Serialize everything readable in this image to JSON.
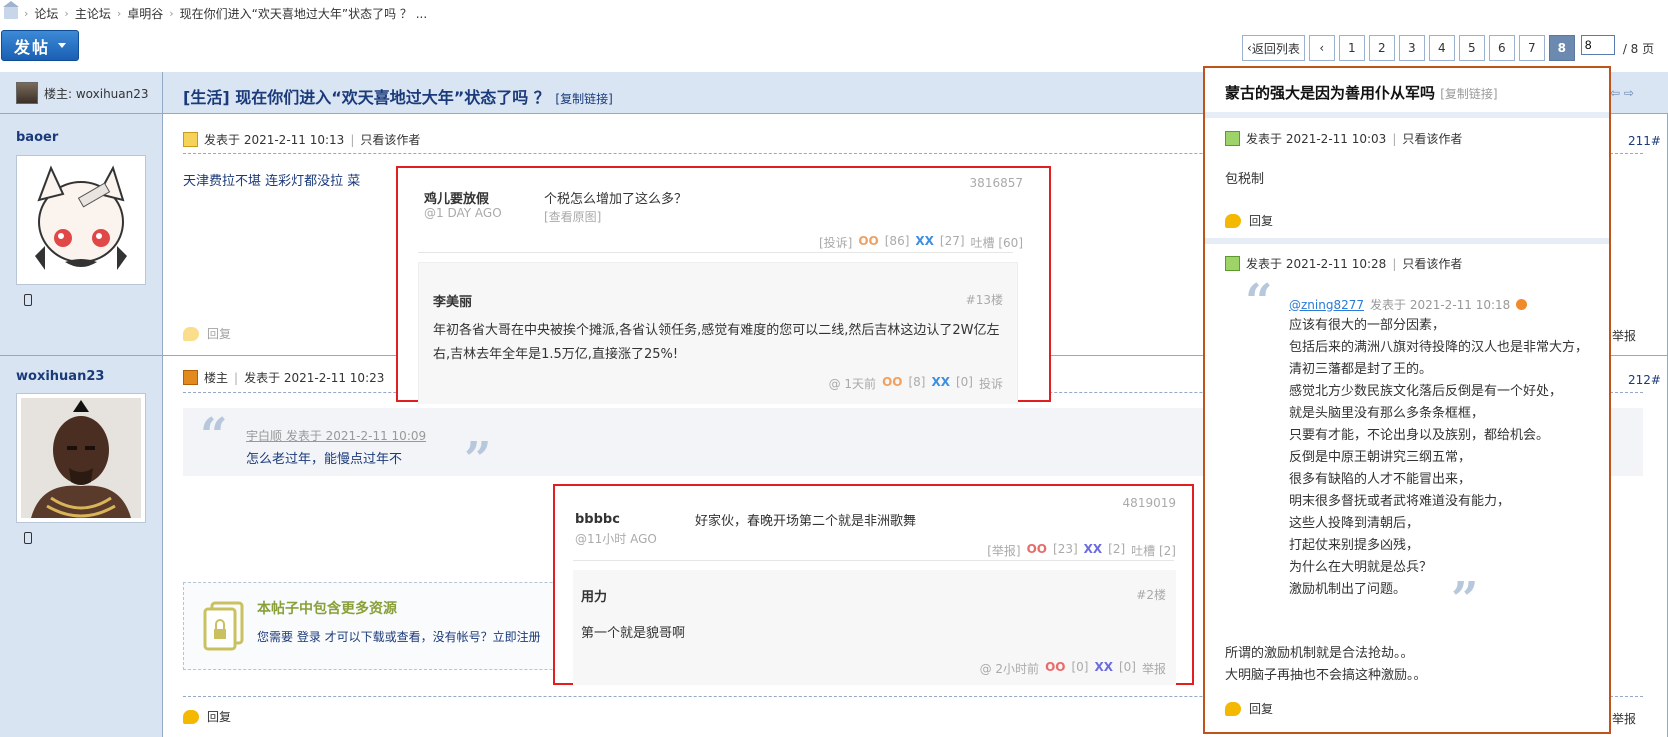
{
  "breadcrumb": {
    "items": [
      "论坛",
      "主论坛",
      "卓明谷",
      "现在你们进入“欢天喜地过大年”状态了吗 ？ ..."
    ]
  },
  "toolbar": {
    "post_label": "发帖"
  },
  "pager": {
    "back_label": "返回列表",
    "pages": [
      "1",
      "2",
      "3",
      "4",
      "5",
      "6",
      "7",
      "8"
    ],
    "current": "8",
    "input_value": "8",
    "total_label": "/ 8 页"
  },
  "thread": {
    "op_label": "楼主: woxihuan23",
    "title": "[生活] 现在你们进入“欢天喜地过大年”状态了吗 ？",
    "copy_link": "[复制链接]"
  },
  "posts": [
    {
      "author": "baoer",
      "posted": "发表于 2021-2-11 10:13",
      "only_author": "只看该作者",
      "floor": "211#",
      "content": "天津费拉不堪 连彩灯都没拉 菜",
      "reply": "回复",
      "report": "举报"
    },
    {
      "author": "woxihuan23",
      "host_label": "楼主",
      "posted": "发表于 2021-2-11 10:23",
      "floor": "212#",
      "quote_ref": "宇白顺 发表于 2021-2-11 10:09",
      "quote_text": "怎么老过年，能慢点过年不",
      "resource_title": "本帖子中包含更多资源",
      "resource_text": "您需要 登录 才可以下载或查看，没有帐号？立即注册",
      "reply": "回复",
      "report": "举报"
    }
  ],
  "popup1": {
    "id": "3816857",
    "user": "鸡儿要放假",
    "time": "@1 DAY AGO",
    "text": "个税怎么增加了这么多？",
    "view_orig": "[查看原图]",
    "report": "[投诉]",
    "oo": "OO",
    "oo_count": "[86]",
    "xx": "XX",
    "xx_count": "[27]",
    "tucao": "吐槽 [60]",
    "reply_user": "李美丽",
    "reply_floor": "#13楼",
    "reply_text": "年初各省大哥在中央被挨个摊派,各省认领任务,感觉有难度的您可以二线,然后吉林这边认了2W亿左右,吉林去年全年是1.5万亿,直接涨了25%!",
    "reply_time": "@ 1天前",
    "reply_oo": "OO",
    "reply_oo_count": "[8]",
    "reply_xx": "XX",
    "reply_xx_count": "[0]",
    "reply_report": "投诉"
  },
  "popup2": {
    "id": "4819019",
    "user": "bbbbc",
    "time": "@11小时 AGO",
    "text": "好家伙，春晚开场第二个就是非洲歌舞",
    "report": "[举报]",
    "oo": "OO",
    "oo_count": "[23]",
    "xx": "XX",
    "xx_count": "[2]",
    "tucao": "吐槽 [2]",
    "reply_user": "用力",
    "reply_floor": "#2楼",
    "reply_text": "第一个就是貌哥啊",
    "reply_time": "@ 2小时前",
    "reply_oo": "OO",
    "reply_oo_count": "[0]",
    "reply_xx": "XX",
    "reply_xx_count": "[0]",
    "reply_report": "举报"
  },
  "right_panel": {
    "title": "蒙古的强大是因为善用仆从军吗",
    "copy_link": "[复制链接]",
    "post1_time": "发表于 2021-2-11 10:03",
    "only_author": "只看该作者",
    "post1_text": "包税制",
    "reply": "回复",
    "post2_time": "发表于 2021-2-11 10:28",
    "quote_user": "@zning8277",
    "quote_time": "发表于 2021-2-11 10:18",
    "quote_lines": [
      "应该有很大的一部分因素，",
      "包括后来的满洲八旗对待投降的汉人也是非常大方，",
      "清初三藩都是封了王的。",
      "感觉北方少数民族文化落后反倒是有一个好处，",
      "就是头脑里没有那么多条条框框，",
      "只要有才能，不论出身以及族别，都给机会。",
      "反倒是中原王朝讲究三纲五常，",
      "很多有缺陷的人才不能冒出来，",
      "明末很多督抚或者武将难道没有能力，",
      "这些人投降到清朝后，",
      "打起仗来别提多凶残，",
      "为什么在大明就是怂兵？",
      "激励机制出了问题。"
    ],
    "post2_line1": "所谓的激励机制就是合法抢劫。。",
    "post2_line2": "大明脑子再抽也不会搞这种激励。。"
  },
  "colors": {
    "accent_blue": "#1b3a7a",
    "popup_border": "#e02020",
    "panel_border": "#c0531b",
    "header_bg": "#d9e5f3"
  }
}
